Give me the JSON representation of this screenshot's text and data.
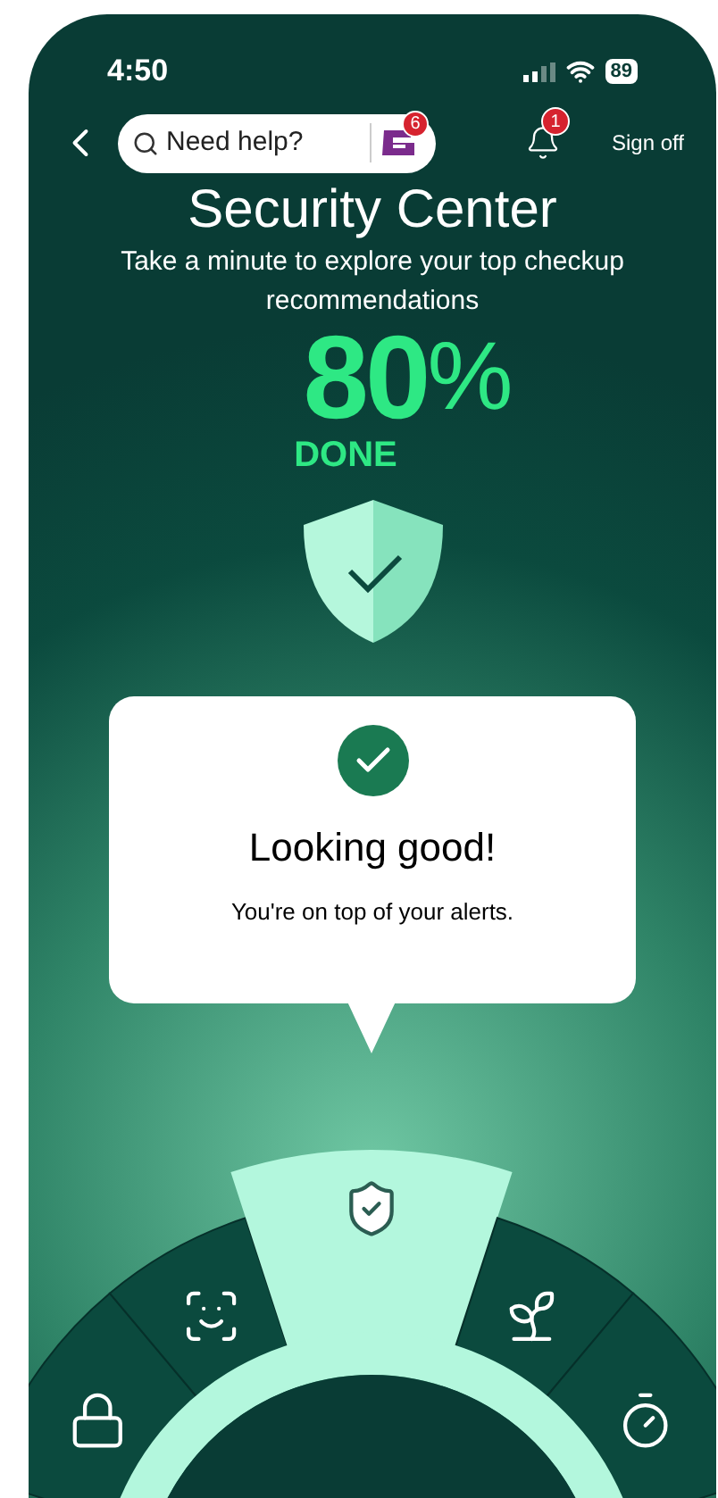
{
  "status_bar": {
    "time": "4:50",
    "battery": "89"
  },
  "header": {
    "search": {
      "placeholder": "Need help?"
    },
    "chat_badge": "6",
    "notification_badge": "1",
    "sign_off": "Sign off"
  },
  "title": "Security Center",
  "subtitle": "Take a minute to explore your top checkup recommendations",
  "progress": {
    "percent": "80",
    "percent_sign": "%",
    "label": "DONE"
  },
  "status_card": {
    "title": "Looking good!",
    "message": "You're on top of your alerts."
  },
  "dial": {
    "segments": [
      {
        "kind": "lock",
        "selected": false
      },
      {
        "kind": "face",
        "selected": false
      },
      {
        "kind": "shield",
        "selected": true
      },
      {
        "kind": "leaf",
        "selected": false
      },
      {
        "kind": "clock",
        "selected": false
      }
    ]
  }
}
